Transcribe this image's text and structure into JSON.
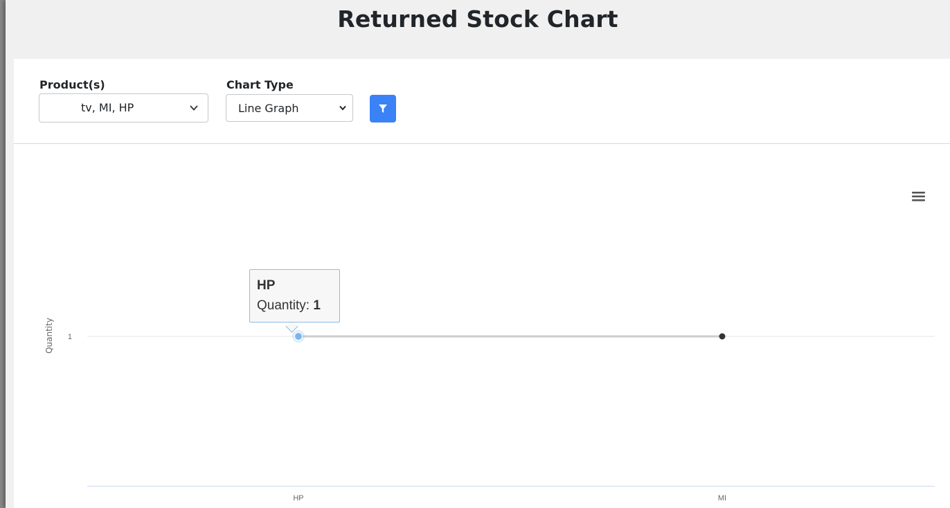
{
  "page": {
    "title": "Returned Stock Chart"
  },
  "filters": {
    "products_label": "Product(s)",
    "products_value": "tv, MI, HP",
    "chart_type_label": "Chart Type",
    "chart_type_value": "Line Graph"
  },
  "colors": {
    "accent": "#3b82f6",
    "series_line": "#cccccc",
    "point": "#333333",
    "hover_point": "#7cb5ec"
  },
  "icons": {
    "filter": "filter-icon",
    "menu": "hamburger-menu-icon",
    "dropdown": "chevron-down-icon"
  },
  "tooltip": {
    "title": "HP",
    "label": "Quantity: ",
    "value": "1"
  },
  "chart_data": {
    "type": "line",
    "categories": [
      "HP",
      "MI"
    ],
    "values": [
      1,
      1
    ],
    "ylabel": "Quantity",
    "yticks": [
      "1"
    ],
    "ylim": [
      0,
      1
    ],
    "grid": true,
    "highlighted_point": "HP"
  }
}
